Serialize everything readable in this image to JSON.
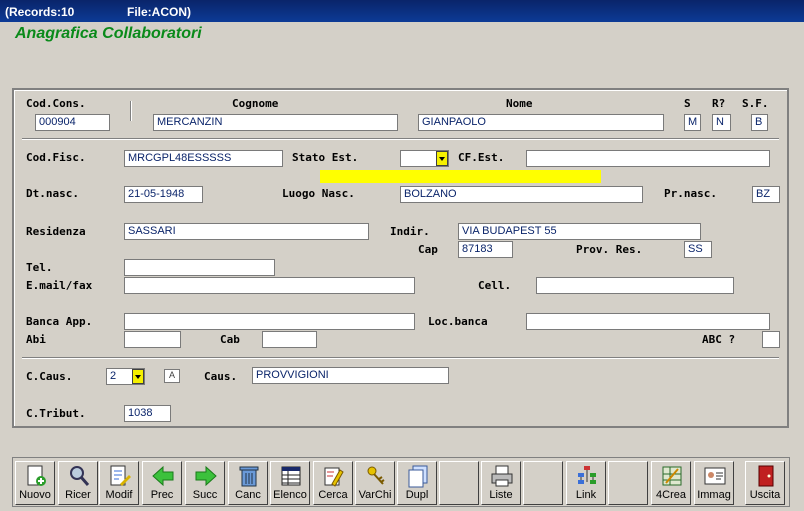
{
  "titlebar": {
    "records": "(Records:10",
    "file": "File:ACON)"
  },
  "heading": "Anagrafica Collaboratori",
  "labels": {
    "cod_cons": "Cod.Cons.",
    "cognome": "Cognome",
    "nome": "Nome",
    "s": "S",
    "r": "R?",
    "sf": "S.F.",
    "cod_fisc": "Cod.Fisc.",
    "stato_est": "Stato Est.",
    "cf_est": "CF.Est.",
    "dt_nasc": "Dt.nasc.",
    "luogo_nasc": "Luogo Nasc.",
    "pr_nasc": "Pr.nasc.",
    "residenza": "Residenza",
    "indir": "Indir.",
    "cap": "Cap",
    "prov_res": "Prov. Res.",
    "tel": "Tel.",
    "email": "E.mail/fax",
    "cell": "Cell.",
    "banca": "Banca App.",
    "loc_banca": "Loc.banca",
    "abi": "Abi",
    "cab": "Cab",
    "abc": "ABC ?",
    "c_caus": "C.Caus.",
    "caus": "Caus.",
    "c_tribut": "C.Tribut."
  },
  "values": {
    "cod_cons": "000904",
    "cognome": "MERCANZIN",
    "nome": "GIANPAOLO",
    "s": "M",
    "r": "N",
    "sf": "B",
    "cod_fisc": "MRCGPL48ESSSSS",
    "stato_est": "",
    "cf_est": "",
    "dt_nasc": "21-05-1948",
    "luogo_nasc": "BOLZANO",
    "pr_nasc": "BZ",
    "residenza": "SASSARI",
    "indir": "VIA BUDAPEST 55",
    "cap": "87183",
    "prov_res": "SS",
    "tel": "",
    "email": "",
    "cell": "",
    "banca": "",
    "loc_banca": "",
    "abi": "",
    "cab": "",
    "abc": "",
    "c_caus": "2",
    "c_caus_flag": "A",
    "caus": "PROVVIGIONI",
    "c_tribut": "1038"
  },
  "toolbar": [
    {
      "label": "Nuovo",
      "icon": "new-doc-icon"
    },
    {
      "label": "Ricer",
      "icon": "search-icon"
    },
    {
      "label": "Modif",
      "icon": "edit-icon"
    },
    {
      "label": "Prec",
      "icon": "arrow-left-icon"
    },
    {
      "label": "Succ",
      "icon": "arrow-right-icon"
    },
    {
      "label": "Canc",
      "icon": "trash-icon"
    },
    {
      "label": "Elenco",
      "icon": "list-icon"
    },
    {
      "label": "Cerca",
      "icon": "find-icon"
    },
    {
      "label": "VarChi",
      "icon": "keys-icon"
    },
    {
      "label": "Dupl",
      "icon": "duplicate-icon"
    },
    {
      "label": "",
      "icon": ""
    },
    {
      "label": "Liste",
      "icon": "printer-icon"
    },
    {
      "label": "",
      "icon": ""
    },
    {
      "label": "Link",
      "icon": "link-icon"
    },
    {
      "label": "",
      "icon": ""
    },
    {
      "label": "4Crea",
      "icon": "create-icon"
    },
    {
      "label": "Immag",
      "icon": "image-icon"
    },
    {
      "label": "Uscita",
      "icon": "exit-icon"
    }
  ]
}
